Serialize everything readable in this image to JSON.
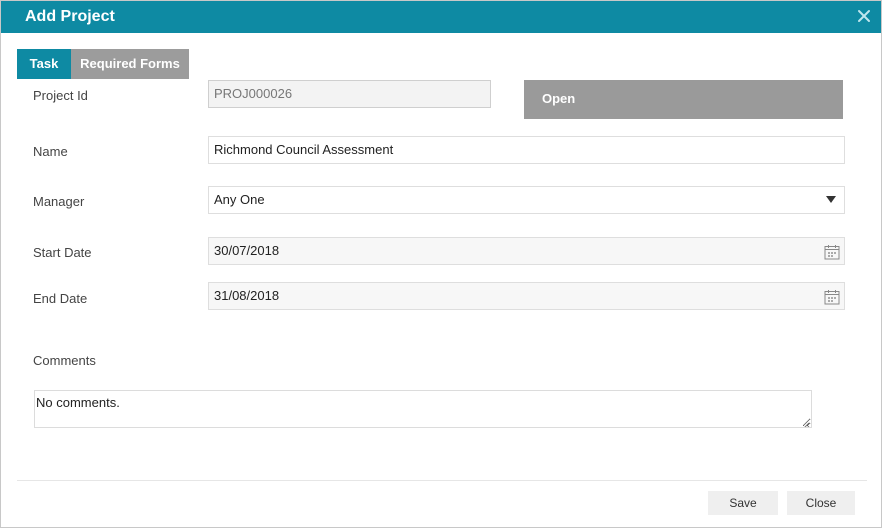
{
  "dialog": {
    "title": "Add Project"
  },
  "tabs": [
    {
      "label": "Task",
      "active": true
    },
    {
      "label": "Required Forms",
      "active": false
    }
  ],
  "form": {
    "project_id": {
      "label": "Project Id",
      "value": "PROJ000026"
    },
    "status": {
      "label": "Open"
    },
    "name": {
      "label": "Name",
      "value": "Richmond Council Assessment"
    },
    "manager": {
      "label": "Manager",
      "value": "Any One"
    },
    "start_date": {
      "label": "Start Date",
      "value": "30/07/2018"
    },
    "end_date": {
      "label": "End Date",
      "value": "31/08/2018"
    },
    "comments": {
      "label": "Comments",
      "value": "No comments."
    }
  },
  "footer": {
    "save_label": "Save",
    "close_label": "Close"
  },
  "colors": {
    "accent": "#0e8aa3",
    "inactive_tab": "#9c9c9c",
    "status_button": "#9a9a9a"
  },
  "icons": {
    "close": "close-icon",
    "dropdown": "chevron-down-icon",
    "calendar": "calendar-icon"
  }
}
